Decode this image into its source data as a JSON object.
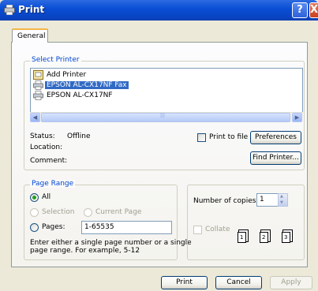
{
  "window": {
    "title": "Print",
    "help_label": "?",
    "close_label": "X"
  },
  "tabs": [
    {
      "label": "General"
    }
  ],
  "select_printer": {
    "legend": "Select Printer",
    "printers": [
      {
        "label": "Add Printer",
        "icon": "add-printer-icon",
        "selected": false
      },
      {
        "label": "EPSON AL-CX17NF Fax",
        "icon": "fax-printer-icon",
        "selected": true
      },
      {
        "label": "EPSON AL-CX17NF",
        "icon": "printer-icon",
        "selected": false
      }
    ],
    "status_label": "Status:",
    "status_value": "Offline",
    "location_label": "Location:",
    "location_value": "",
    "comment_label": "Comment:",
    "comment_value": "",
    "print_to_file_label": "Print to file",
    "print_to_file_checked": false,
    "preferences_label": "Preferences",
    "find_printer_label": "Find Printer..."
  },
  "page_range": {
    "legend": "Page Range",
    "all_label": "All",
    "selection_label": "Selection",
    "current_page_label": "Current Page",
    "pages_label": "Pages:",
    "pages_value": "1-65535",
    "selected": "all",
    "help_text_line1": "Enter either a single page number or a single",
    "help_text_line2": "page range.  For example, 5-12"
  },
  "copies": {
    "number_label": "Number of copies:",
    "number_value": "1",
    "collate_label": "Collate",
    "collate_checked": false,
    "collate_pages": [
      "1",
      "1",
      "2",
      "2",
      "3",
      "3"
    ]
  },
  "footer": {
    "print_label": "Print",
    "cancel_label": "Cancel",
    "apply_label": "Apply"
  },
  "colors": {
    "title_bar": "#0a4fd6",
    "legend_text": "#0046d5",
    "selection": "#316ac5",
    "dialog_bg": "#ece9d8"
  }
}
